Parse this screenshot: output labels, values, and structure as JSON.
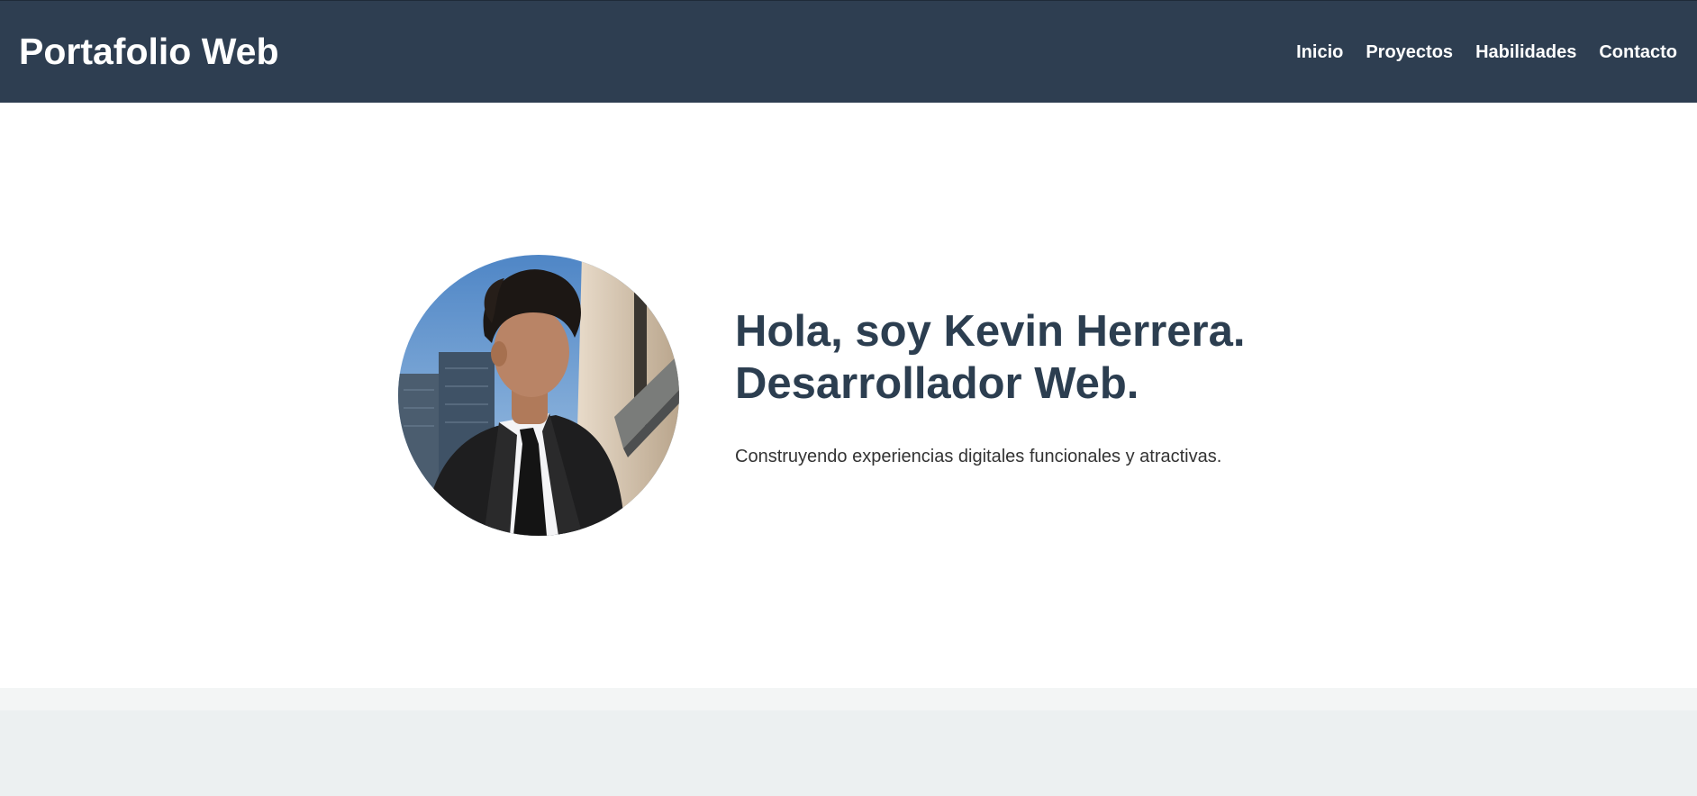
{
  "header": {
    "brand": "Portafolio Web",
    "nav": [
      {
        "label": "Inicio"
      },
      {
        "label": "Proyectos"
      },
      {
        "label": "Habilidades"
      },
      {
        "label": "Contacto"
      }
    ]
  },
  "hero": {
    "headline_line1": "Hola, soy Kevin Herrera.",
    "headline_line2": "Desarrollador Web.",
    "tagline": "Construyendo experiencias digitales funcionales y atractivas.",
    "photo_icon": "profile-photo"
  },
  "colors": {
    "header_bg": "#2e3e51",
    "heading_text": "#2c3e50",
    "body_text": "#333333",
    "page_bg": "#ffffff",
    "section_bg": "#ecf0f1"
  }
}
